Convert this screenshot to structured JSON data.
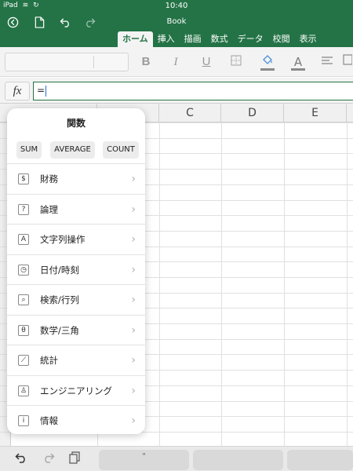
{
  "status": {
    "device": "iPad",
    "time": "10:40"
  },
  "window": {
    "title": "Book"
  },
  "toolbar": {
    "icons": [
      "back-circle-icon",
      "file-icon",
      "undo-icon",
      "redo-icon"
    ]
  },
  "ribbon_tabs": [
    "ホーム",
    "挿入",
    "描画",
    "数式",
    "データ",
    "校閲",
    "表示"
  ],
  "ribbon": {
    "bold": "B",
    "italic": "I",
    "underline": "U",
    "font_color_label": "A",
    "icons": [
      "borders-icon",
      "fill-color-icon",
      "align-icon",
      "wrap-icon"
    ]
  },
  "formula": {
    "fx_label": "fx",
    "value": "="
  },
  "grid": {
    "columns": [
      "C",
      "D",
      "E"
    ]
  },
  "functions": {
    "title": "関数",
    "quick": [
      "SUM",
      "AVERAGE",
      "COUNT"
    ],
    "categories": [
      {
        "icon": "financial-icon",
        "glyph": "$",
        "label": "財務"
      },
      {
        "icon": "logical-icon",
        "glyph": "?",
        "label": "論理"
      },
      {
        "icon": "text-icon",
        "glyph": "A",
        "label": "文字列操作"
      },
      {
        "icon": "date-time-icon",
        "glyph": "◷",
        "label": "日付/時刻"
      },
      {
        "icon": "lookup-icon",
        "glyph": "⌕",
        "label": "検索/行列"
      },
      {
        "icon": "math-trig-icon",
        "glyph": "θ",
        "label": "数学/三角"
      },
      {
        "icon": "statistical-icon",
        "glyph": "⟋",
        "label": "統計"
      },
      {
        "icon": "engineering-icon",
        "glyph": "♙",
        "label": "エンジニアリング"
      },
      {
        "icon": "information-icon",
        "glyph": "i",
        "label": "情報"
      }
    ]
  },
  "bottom": {
    "key_label": "\""
  },
  "colors": {
    "accent": "#237346",
    "ribbon_bg": "#f3f3f3"
  }
}
